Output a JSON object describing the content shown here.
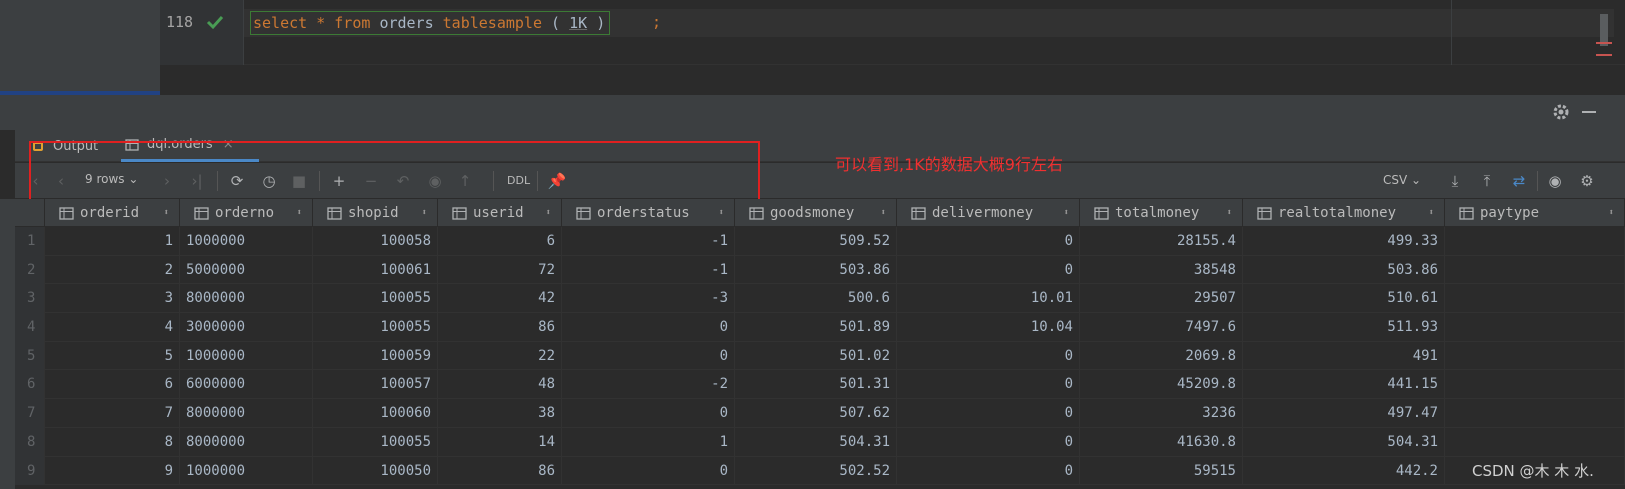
{
  "editor": {
    "line_number": "118",
    "sql": {
      "kw_select": "select",
      "star": "*",
      "kw_from": "from",
      "table": "orders",
      "kw_tablesample": "tablesample",
      "lparen": "(",
      "size": "1K",
      "rparen": ")",
      "semicolon": ";"
    }
  },
  "tabs": [
    {
      "label": "Output",
      "icon": "output-icon"
    },
    {
      "label": "dql.orders",
      "icon": "table-icon",
      "close": "×"
    }
  ],
  "toolbar": {
    "rows_label": "9 rows",
    "ddl_label": "DDL",
    "csv_label": "CSV"
  },
  "annotation": {
    "text": "可以看到,1K的数据大概9行左右"
  },
  "table": {
    "columns": [
      "orderid",
      "orderno",
      "shopid",
      "userid",
      "orderstatus",
      "goodsmoney",
      "delivermoney",
      "totalmoney",
      "realtotalmoney",
      "paytype"
    ],
    "rows": [
      [
        "1",
        "1",
        "1000000",
        "100058",
        "6",
        "-1",
        "509.52",
        "0",
        "28155.4",
        "499.33",
        ""
      ],
      [
        "2",
        "2",
        "5000000",
        "100061",
        "72",
        "-1",
        "503.86",
        "0",
        "38548",
        "503.86",
        ""
      ],
      [
        "3",
        "3",
        "8000000",
        "100055",
        "42",
        "-3",
        "500.6",
        "10.01",
        "29507",
        "510.61",
        ""
      ],
      [
        "4",
        "4",
        "3000000",
        "100055",
        "86",
        "0",
        "501.89",
        "10.04",
        "7497.6",
        "511.93",
        ""
      ],
      [
        "5",
        "5",
        "1000000",
        "100059",
        "22",
        "0",
        "501.02",
        "0",
        "2069.8",
        "491",
        ""
      ],
      [
        "6",
        "6",
        "6000000",
        "100057",
        "48",
        "-2",
        "501.31",
        "0",
        "45209.8",
        "441.15",
        ""
      ],
      [
        "7",
        "7",
        "8000000",
        "100060",
        "38",
        "0",
        "507.62",
        "0",
        "3236",
        "497.47",
        ""
      ],
      [
        "8",
        "8",
        "8000000",
        "100055",
        "14",
        "1",
        "504.31",
        "0",
        "41630.8",
        "504.31",
        ""
      ],
      [
        "9",
        "9",
        "1000000",
        "100050",
        "86",
        "0",
        "502.52",
        "0",
        "59515",
        "442.2",
        ""
      ]
    ]
  },
  "watermark": "CSDN @木 木 水.",
  "colors": {
    "accent": "#4a88c7",
    "keyword": "#cc7832",
    "annotation": "#e02020",
    "success": "#499c54"
  }
}
